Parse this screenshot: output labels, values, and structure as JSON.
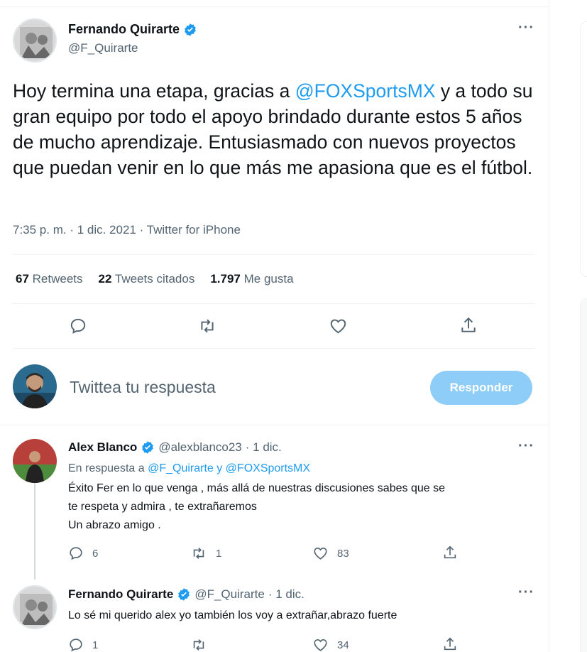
{
  "main_tweet": {
    "author_name": "Fernando Quirarte",
    "author_handle": "@F_Quirarte",
    "text_before": "Hoy termina una etapa, gracias a ",
    "mention": "@FOXSportsMX",
    "text_after": " y a todo su gran equipo por todo el apoyo brindado durante estos 5 años de mucho aprendizaje. Entusiasmado con nuevos proyectos que puedan venir en lo que más me apasiona que es el fútbol.",
    "meta": "7:35 p. m. · 1 dic. 2021 · Twitter for iPhone",
    "stats": {
      "retweets_count": "67",
      "retweets_label": "Retweets",
      "quotes_count": "22",
      "quotes_label": "Tweets citados",
      "likes_count": "1.797",
      "likes_label": "Me gusta"
    }
  },
  "compose": {
    "placeholder": "Twittea tu respuesta",
    "button_label": "Responder"
  },
  "replies": [
    {
      "author_name": "Alex Blanco",
      "author_handle": "@alexblanco23",
      "date": "· 1 dic.",
      "in_reply_prefix": "En respuesta a ",
      "in_reply_targets": "@F_Quirarte y @FOXSportsMX",
      "lines": [
        "Éxito Fer en lo que venga , más allá de nuestras discusiones sabes que se",
        "te respeta y admira , te extrañaremos",
        "Un abrazo amigo ."
      ],
      "replies_count": "6",
      "retweets_count": "1",
      "likes_count": "83"
    },
    {
      "author_name": "Fernando Quirarte",
      "author_handle": "@F_Quirarte",
      "date": "· 1 dic.",
      "lines": [
        "Lo sé mi querido alex yo también los voy a extrañar,abrazo fuerte"
      ],
      "replies_count": "1",
      "retweets_count": "",
      "likes_count": "34"
    }
  ],
  "icons": {
    "more": "more-icon",
    "verified": "verified-badge-icon",
    "reply": "reply-icon",
    "retweet": "retweet-icon",
    "like": "like-icon",
    "share": "share-icon"
  },
  "colors": {
    "accent": "#1d9bf0",
    "button_disabled": "#8ecdf8",
    "secondary_text": "#536471",
    "border": "#eff3f4"
  }
}
